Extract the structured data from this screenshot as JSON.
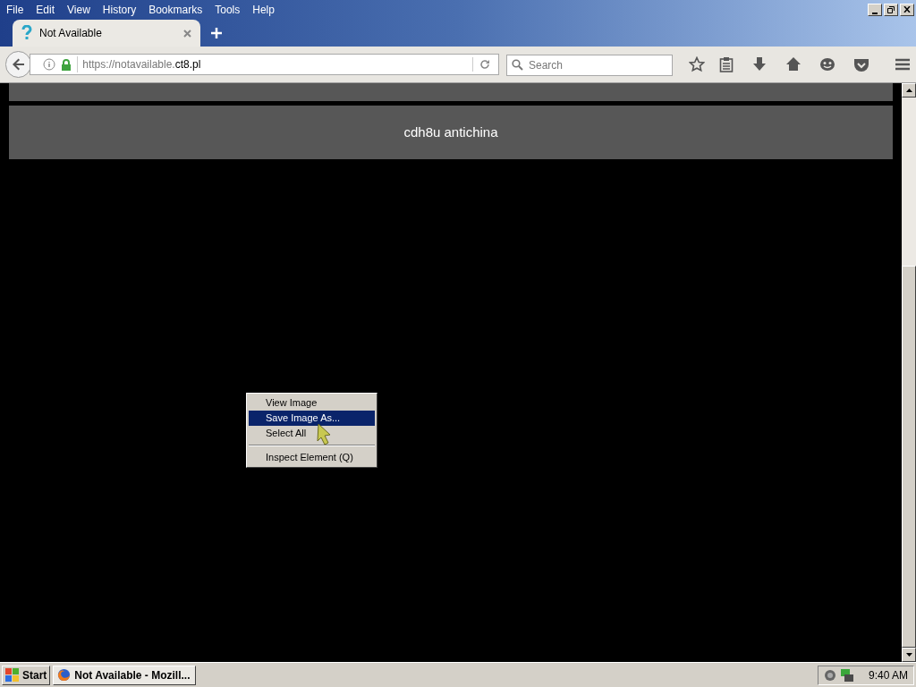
{
  "menu_bar": [
    "File",
    "Edit",
    "View",
    "History",
    "Bookmarks",
    "Tools",
    "Help"
  ],
  "tabs": [
    {
      "title": "Not Available",
      "selected": true
    }
  ],
  "address_bar": {
    "url_prefix": "https://notavailable.",
    "url_domain": "ct8.pl"
  },
  "search": {
    "placeholder": "Search"
  },
  "page": {
    "banner": "cdh8u antichina"
  },
  "context_menu": [
    {
      "kind": "item",
      "label": "View Image",
      "selected": false
    },
    {
      "kind": "item",
      "label": "Save Image As...",
      "selected": true
    },
    {
      "kind": "item",
      "label": "Select All",
      "selected": false
    },
    {
      "kind": "separator"
    },
    {
      "kind": "item",
      "label": "Inspect Element (Q)",
      "selected": false
    }
  ],
  "taskbar": {
    "start": "Start",
    "tasks": [
      {
        "label": "Not Available - Mozill...",
        "selected": false
      }
    ],
    "clock": "9:40 AM"
  }
}
